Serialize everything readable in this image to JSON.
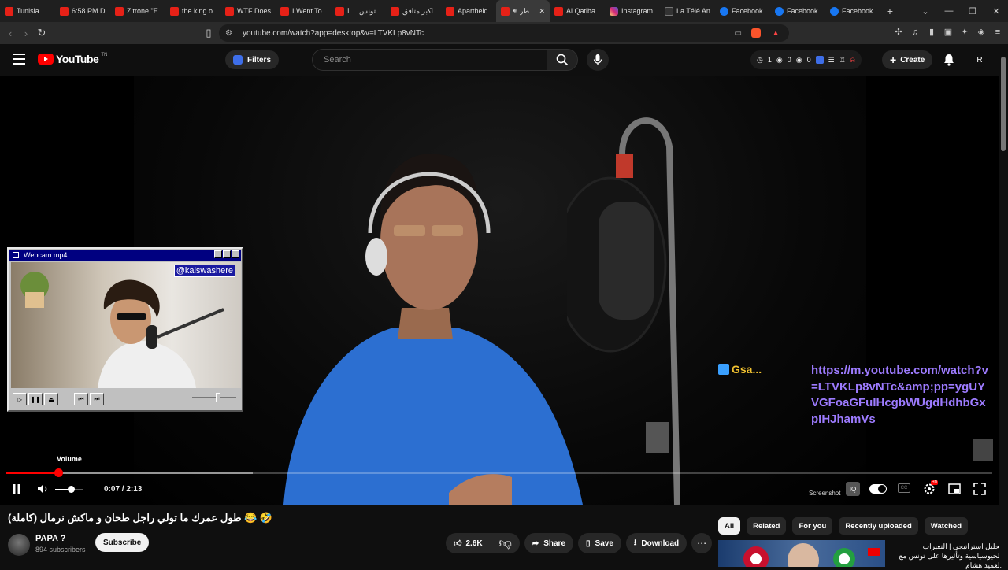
{
  "browser": {
    "tabs": [
      {
        "title": "Tunisia - ...",
        "icon": "youtube-icon"
      },
      {
        "title": "6:58 PM D",
        "icon": "youtube-icon"
      },
      {
        "title": "Zitrone \"E",
        "icon": "youtube-icon"
      },
      {
        "title": "the king o",
        "icon": "youtube-icon"
      },
      {
        "title": "WTF Does",
        "icon": "youtube-icon"
      },
      {
        "title": "I Went To",
        "icon": "youtube-icon"
      },
      {
        "title": "تونس ... ا",
        "icon": "youtube-icon"
      },
      {
        "title": "اكبر متافق",
        "icon": "youtube-icon"
      },
      {
        "title": "Apartheid",
        "icon": "youtube-icon"
      },
      {
        "title": "طر",
        "icon": "youtube-icon",
        "active": true
      },
      {
        "title": "Al Qatiba",
        "icon": "youtube-icon"
      },
      {
        "title": "Instagram",
        "icon": "instagram-icon"
      },
      {
        "title": "La Télé An",
        "icon": "site-icon"
      },
      {
        "title": "Facebook",
        "icon": "facebook-icon"
      },
      {
        "title": "Facebook",
        "icon": "facebook-icon"
      },
      {
        "title": "Facebook",
        "icon": "facebook-icon"
      }
    ],
    "url": "youtube.com/watch?app=desktop&v=LTVKLp8vNTc"
  },
  "header": {
    "logo_text": "YouTube",
    "logo_sup": "TN",
    "filters_label": "Filters",
    "search_placeholder": "Search",
    "stats": [
      "1",
      "0",
      "0"
    ],
    "create_label": "Create",
    "avatar_letter": "R"
  },
  "player": {
    "pip": {
      "title": "Webcam.mp4",
      "handle": "@kaiswashere"
    },
    "overlay_name": "Gsa...",
    "overlay_url": "https://m.youtube.com/watch?v=LTVKLp8vNTc&amp;pp=ygUYVGFoaGFuIHcgbWUgdHdhbGxpIHJhamVs",
    "volume_tooltip": "Volume",
    "time": "0:07 / 2:13",
    "progress_played": 0.053,
    "progress_buffered": 0.25,
    "volume_level": 0.55,
    "screenshot_label": "Screenshot"
  },
  "video_info": {
    "title": "طول عمرك ما تولي راجل طحان و ماكش نرمال (كاملة) 😂 🤣",
    "channel_name": "PAPA ?",
    "subscribers": "894 subscribers",
    "subscribe_label": "Subscribe",
    "likes": "2.6K",
    "share_label": "Share",
    "save_label": "Save",
    "download_label": "Download"
  },
  "sidebar": {
    "chips": [
      "All",
      "Related",
      "For you",
      "Recently uploaded",
      "Watched"
    ],
    "active_chip": "All",
    "rec_title": "تحليل استراتيجي | التغيرات الجيوسياسية وتأثيرها على تونس مع العميد هشام"
  },
  "colors": {
    "accent": "#ff0000",
    "overlay_url": "#9d7bff",
    "overlay_name": "#f2c230"
  }
}
